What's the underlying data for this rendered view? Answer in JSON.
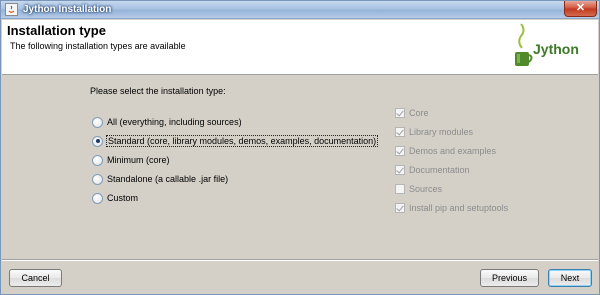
{
  "window": {
    "title": "Jython Installation",
    "close_glyph": "✕"
  },
  "header": {
    "title": "Installation type",
    "subtitle": "The following installation types are available",
    "logo_text": "Jython"
  },
  "main": {
    "prompt": "Please select the installation type:",
    "install_types": [
      {
        "label": "All (everything, including sources)",
        "selected": false
      },
      {
        "label": "Standard (core, library modules, demos, examples, documentation)",
        "selected": true
      },
      {
        "label": "Minimum (core)",
        "selected": false
      },
      {
        "label": "Standalone (a callable .jar file)",
        "selected": false
      },
      {
        "label": "Custom",
        "selected": false
      }
    ],
    "components": [
      {
        "label": "Core",
        "checked": true,
        "enabled": false
      },
      {
        "label": "Library modules",
        "checked": true,
        "enabled": false
      },
      {
        "label": "Demos and examples",
        "checked": true,
        "enabled": false
      },
      {
        "label": "Documentation",
        "checked": true,
        "enabled": false
      },
      {
        "label": "Sources",
        "checked": false,
        "enabled": false
      },
      {
        "label": "Install pip and setuptools",
        "checked": true,
        "enabled": false
      }
    ]
  },
  "footer": {
    "cancel_label": "Cancel",
    "previous_label": "Previous",
    "next_label": "Next"
  },
  "colors": {
    "accent": "#3c7fb1",
    "logo_green": "#3d7a2a",
    "disabled_text": "#8c8c8c"
  }
}
